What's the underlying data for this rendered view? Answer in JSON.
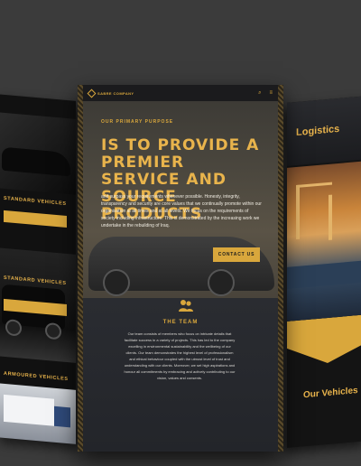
{
  "left_panel": {
    "label_standard": "STANDARD VEHICLES",
    "label_armoured": "ARMOURED VEHICLES",
    "label_extra": ""
  },
  "right_panel": {
    "title": "Logistics",
    "vehicles_title": "Our Vehicles"
  },
  "header": {
    "logo_text": "SABRE COMPANY",
    "search_icon": "⌕",
    "menu_icon": "≡"
  },
  "hero": {
    "eyebrow": "OUR PRIMARY PURPOSE",
    "headline": "IS TO PROVIDE A PREMIER SERVICE AND SOURCE PRODUCTS",
    "intro": "and surpass your requirements whenever possible. Honesty, integrity, transparency and security are core values that we continually promote within our organisation at all times and at all levels. We focus on the requirements of society including infrastructure. This is demonstrated by the increasing work we undertake in the rebuilding of Iraq.",
    "cta": "CONTACT US"
  },
  "team": {
    "title": "THE TEAM",
    "body": "Our team consists of members who focus on intricate details that facilitate success in a variety of projects. This has led to the company excelling in environmental sustainability and the wellbeing of our clients. Our team demonstrates the highest level of professionalism and ethical behaviour coupled with the utmost level of trust and understanding with our clients. Moreover, we set high aspirations and honour all commitments by embracing and actively contributing to our vision, values and consents."
  },
  "colors": {
    "accent": "#d9a73c",
    "background": "#3b3b3b",
    "panel": "#1c1d20"
  }
}
